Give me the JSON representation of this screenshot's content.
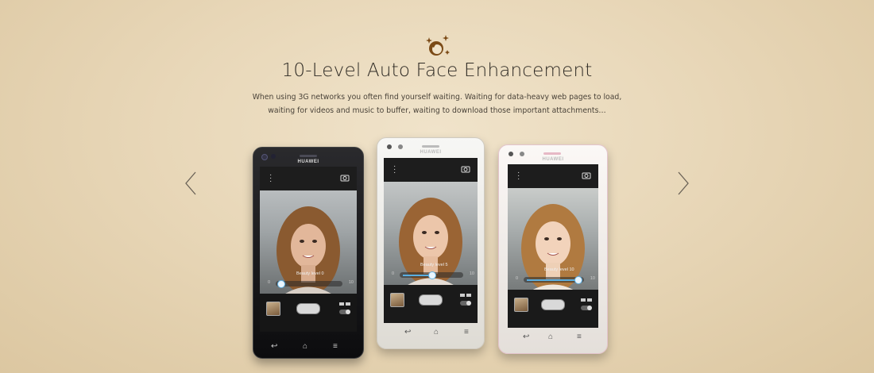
{
  "feature": {
    "icon": "face-beauty-icon",
    "title": "10-Level Auto Face Enhancement",
    "description_line1": "When using 3G networks you often find yourself waiting. Waiting for data-heavy web pages to load,",
    "description_line2": "waiting for videos and music to buffer, waiting to download those important attachments…"
  },
  "phones": [
    {
      "brand": "HUAWEI",
      "color": "black",
      "beauty_label": "Beauty level  0",
      "slider_min": "0",
      "slider_max": "10",
      "level": 0
    },
    {
      "brand": "HUAWEI",
      "color": "white",
      "beauty_label": "Beauty level  5",
      "slider_min": "0",
      "slider_max": "10",
      "level": 5
    },
    {
      "brand": "HUAWEI",
      "color": "pink",
      "beauty_label": "Beauty level 10",
      "slider_min": "0",
      "slider_max": "10",
      "level": 10
    }
  ],
  "carousel": {
    "prev_icon": "chevron-left-icon",
    "next_icon": "chevron-right-icon"
  },
  "colors": {
    "background": "#e8d7b8",
    "icon_gold": "#8a5a1e",
    "slider_blue": "#5aaee0"
  }
}
